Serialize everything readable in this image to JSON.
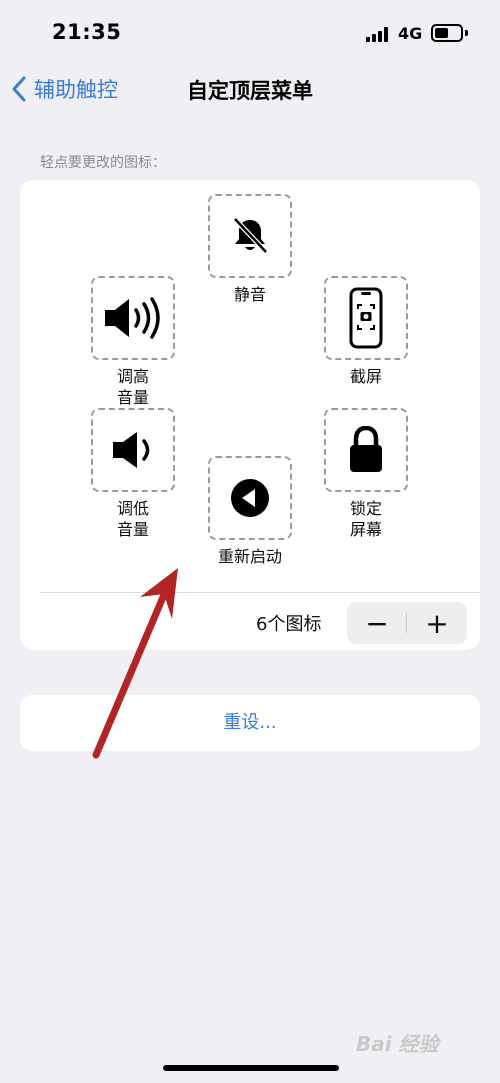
{
  "status": {
    "time": "21:35",
    "network": "4G"
  },
  "nav": {
    "back_label": "辅助触控",
    "title": "自定顶层菜单"
  },
  "section_label": "轻点要更改的图标：",
  "menu": {
    "mute": "静音",
    "volume_up": "调高\n音量",
    "screenshot": "截屏",
    "volume_down": "调低\n音量",
    "lock_screen": "锁定\n屏幕",
    "restart": "重新启动"
  },
  "icon_count": "6个图标",
  "stepper": {
    "minus": "−",
    "plus": "+"
  },
  "reset_label": "重设...",
  "watermark": "Bai 经验",
  "colors": {
    "accent": "#3b7bd8",
    "arrow": "#b32424",
    "background": "#efeff4"
  }
}
